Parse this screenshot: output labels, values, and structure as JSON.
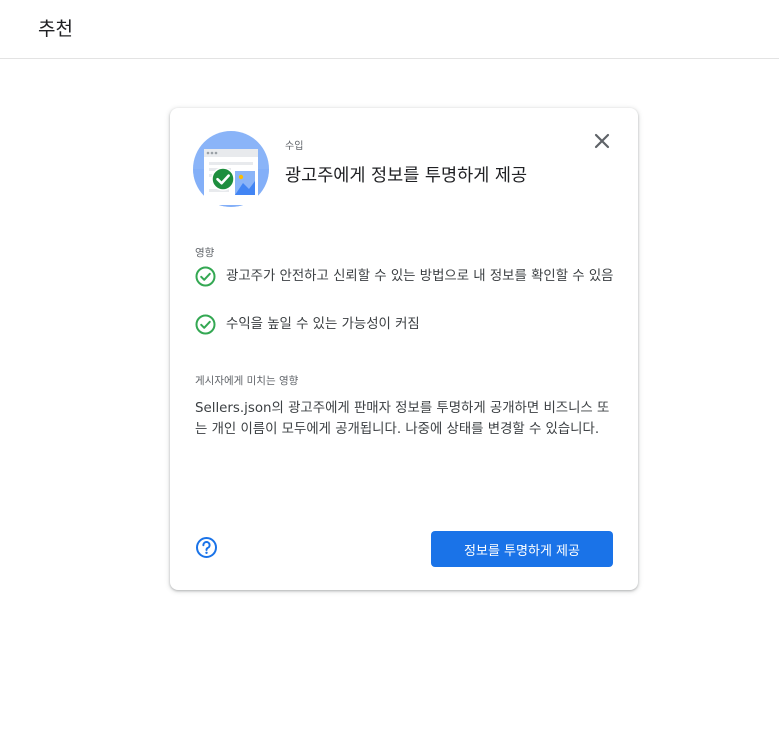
{
  "header": {
    "title": "추천"
  },
  "card": {
    "eyebrow": "수입",
    "title": "광고주에게 정보를 투명하게 제공",
    "impact": {
      "label": "영향",
      "items": [
        {
          "text": "광고주가 안전하고 신뢰할 수 있는 방법으로 내 정보를 확인할 수 있음"
        },
        {
          "text": "수익을 높일 수 있는 가능성이 커짐"
        }
      ]
    },
    "publisher_impact": {
      "label": "게시자에게 미치는 영향",
      "text": "Sellers.json의 광고주에게 판매자 정보를 투명하게 공개하면 비즈니스 또는 개인 이름이 모두에게 공개됩니다. 나중에 상태를 변경할 수 있습니다."
    },
    "action_label": "정보를 투명하게 제공"
  },
  "colors": {
    "accent": "#1a73e8",
    "check": "#34a853",
    "illustration_bg": "#8ab4f8"
  },
  "icons": [
    "browser-illustration-icon",
    "close-icon",
    "check-circle-icon",
    "help-icon"
  ]
}
